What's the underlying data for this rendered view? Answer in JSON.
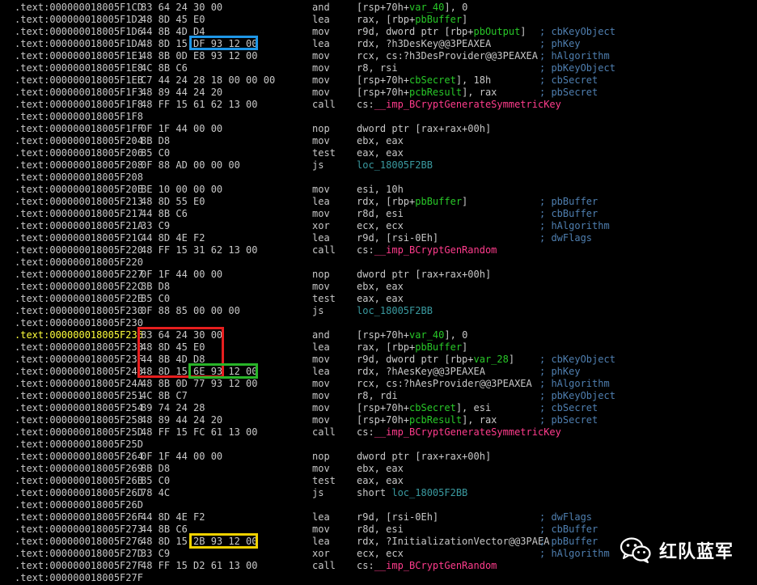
{
  "colors": {
    "background": "#000000",
    "address": "#c8c8c8",
    "current_address": "#ffff3c",
    "comment": "#4f7fb0",
    "variable": "#28c828",
    "label": "#3a9aa0",
    "import": "#ff3c8c",
    "symbol": "#ffd24a",
    "box_blue": "#1e96e6",
    "box_red": "#e61e1e",
    "box_green": "#28b428",
    "box_yellow": "#f0d200"
  },
  "lines": [
    {
      "addr": ".text:000000018005F1CD",
      "bytes": "83 64 24 30 00",
      "mnemonic": "and",
      "operands": [
        {
          "t": "[rsp+70h+",
          "k": "plain"
        },
        {
          "t": "var_40",
          "k": "green"
        },
        {
          "t": "], 0",
          "k": "plain"
        }
      ],
      "comment": ""
    },
    {
      "addr": ".text:000000018005F1D2",
      "bytes": "48 8D 45 E0",
      "mnemonic": "lea",
      "operands": [
        {
          "t": "rax, [rbp+",
          "k": "plain"
        },
        {
          "t": "pbBuffer",
          "k": "green"
        },
        {
          "t": "]",
          "k": "plain"
        }
      ],
      "comment": ""
    },
    {
      "addr": ".text:000000018005F1D6",
      "bytes": "44 8B 4D D4",
      "mnemonic": "mov",
      "operands": [
        {
          "t": "r9d, dword ptr [rbp+",
          "k": "plain"
        },
        {
          "t": "pbOutput",
          "k": "green"
        },
        {
          "t": "]",
          "k": "plain"
        }
      ],
      "comment": "; cbKeyObject"
    },
    {
      "addr": ".text:000000018005F1DA",
      "bytes": "48 8D 15 DF 93 12 00",
      "mnemonic": "lea",
      "operands": [
        {
          "t": "rdx, ?h3DesKey@@3PEAXEA",
          "k": "plain"
        }
      ],
      "comment": "; phKey"
    },
    {
      "addr": ".text:000000018005F1E1",
      "bytes": "48 8B 0D E8 93 12 00",
      "mnemonic": "mov",
      "operands": [
        {
          "t": "rcx, cs:?h3DesProvider@@3PEAXEA",
          "k": "plain"
        }
      ],
      "comment": "; hAlgorithm"
    },
    {
      "addr": ".text:000000018005F1E8",
      "bytes": "4C 8B C6",
      "mnemonic": "mov",
      "operands": [
        {
          "t": "r8, rsi",
          "k": "plain"
        }
      ],
      "comment": "; pbKeyObject"
    },
    {
      "addr": ".text:000000018005F1EB",
      "bytes": "C7 44 24 28 18 00 00 00",
      "mnemonic": "mov",
      "operands": [
        {
          "t": "[rsp+70h+",
          "k": "plain"
        },
        {
          "t": "cbSecret",
          "k": "green"
        },
        {
          "t": "], 18h",
          "k": "plain"
        }
      ],
      "comment": "; cbSecret"
    },
    {
      "addr": ".text:000000018005F1F3",
      "bytes": "48 89 44 24 20",
      "mnemonic": "mov",
      "operands": [
        {
          "t": "[rsp+70h+",
          "k": "plain"
        },
        {
          "t": "pcbResult",
          "k": "green"
        },
        {
          "t": "], rax",
          "k": "plain"
        }
      ],
      "comment": "; pbSecret"
    },
    {
      "addr": ".text:000000018005F1F8",
      "bytes": "48 FF 15 61 62 13 00",
      "mnemonic": "call",
      "operands": [
        {
          "t": "cs:",
          "k": "plain"
        },
        {
          "t": "__imp_BCryptGenerateSymmetricKey",
          "k": "pink"
        }
      ],
      "comment": ""
    },
    {
      "addr": ".text:000000018005F1F8",
      "bytes": "",
      "mnemonic": "",
      "operands": [],
      "comment": ""
    },
    {
      "addr": ".text:000000018005F1FF",
      "bytes": "0F 1F 44 00 00",
      "mnemonic": "nop",
      "operands": [
        {
          "t": "dword ptr [rax+rax+00h]",
          "k": "plain"
        }
      ],
      "comment": ""
    },
    {
      "addr": ".text:000000018005F204",
      "bytes": "8B D8",
      "mnemonic": "mov",
      "operands": [
        {
          "t": "ebx, eax",
          "k": "plain"
        }
      ],
      "comment": ""
    },
    {
      "addr": ".text:000000018005F206",
      "bytes": "85 C0",
      "mnemonic": "test",
      "operands": [
        {
          "t": "eax, eax",
          "k": "plain"
        }
      ],
      "comment": ""
    },
    {
      "addr": ".text:000000018005F208",
      "bytes": "0F 88 AD 00 00 00",
      "mnemonic": "js",
      "operands": [
        {
          "t": "loc_18005F2BB",
          "k": "teal"
        }
      ],
      "comment": ""
    },
    {
      "addr": ".text:000000018005F208",
      "bytes": "",
      "mnemonic": "",
      "operands": [],
      "comment": ""
    },
    {
      "addr": ".text:000000018005F20E",
      "bytes": "BE 10 00 00 00",
      "mnemonic": "mov",
      "operands": [
        {
          "t": "esi, 10h",
          "k": "plain"
        }
      ],
      "comment": ""
    },
    {
      "addr": ".text:000000018005F213",
      "bytes": "48 8D 55 E0",
      "mnemonic": "lea",
      "operands": [
        {
          "t": "rdx, [rbp+",
          "k": "plain"
        },
        {
          "t": "pbBuffer",
          "k": "green"
        },
        {
          "t": "]",
          "k": "plain"
        }
      ],
      "comment": "; pbBuffer"
    },
    {
      "addr": ".text:000000018005F217",
      "bytes": "44 8B C6",
      "mnemonic": "mov",
      "operands": [
        {
          "t": "r8d, esi",
          "k": "plain"
        }
      ],
      "comment": "; cbBuffer"
    },
    {
      "addr": ".text:000000018005F21A",
      "bytes": "33 C9",
      "mnemonic": "xor",
      "operands": [
        {
          "t": "ecx, ecx",
          "k": "plain"
        }
      ],
      "comment": "; hAlgorithm"
    },
    {
      "addr": ".text:000000018005F21C",
      "bytes": "44 8D 4E F2",
      "mnemonic": "lea",
      "operands": [
        {
          "t": "r9d, [rsi-0Eh]",
          "k": "plain"
        }
      ],
      "comment": "; dwFlags"
    },
    {
      "addr": ".text:000000018005F220",
      "bytes": "48 FF 15 31 62 13 00",
      "mnemonic": "call",
      "operands": [
        {
          "t": "cs:",
          "k": "plain"
        },
        {
          "t": "__imp_BCryptGenRandom",
          "k": "pink"
        }
      ],
      "comment": ""
    },
    {
      "addr": ".text:000000018005F220",
      "bytes": "",
      "mnemonic": "",
      "operands": [],
      "comment": ""
    },
    {
      "addr": ".text:000000018005F227",
      "bytes": "0F 1F 44 00 00",
      "mnemonic": "nop",
      "operands": [
        {
          "t": "dword ptr [rax+rax+00h]",
          "k": "plain"
        }
      ],
      "comment": ""
    },
    {
      "addr": ".text:000000018005F22C",
      "bytes": "8B D8",
      "mnemonic": "mov",
      "operands": [
        {
          "t": "ebx, eax",
          "k": "plain"
        }
      ],
      "comment": ""
    },
    {
      "addr": ".text:000000018005F22E",
      "bytes": "85 C0",
      "mnemonic": "test",
      "operands": [
        {
          "t": "eax, eax",
          "k": "plain"
        }
      ],
      "comment": ""
    },
    {
      "addr": ".text:000000018005F230",
      "bytes": "0F 88 85 00 00 00",
      "mnemonic": "js",
      "operands": [
        {
          "t": "loc_18005F2BB",
          "k": "teal"
        }
      ],
      "comment": ""
    },
    {
      "addr": ".text:000000018005F230",
      "bytes": "",
      "mnemonic": "",
      "operands": [],
      "comment": ""
    },
    {
      "addr": ".text:000000018005F236",
      "bytes": "83 64 24 30 00",
      "mnemonic": "and",
      "operands": [
        {
          "t": "[rsp+70h+",
          "k": "plain"
        },
        {
          "t": "var_40",
          "k": "green"
        },
        {
          "t": "], 0",
          "k": "plain"
        }
      ],
      "comment": "",
      "current": true
    },
    {
      "addr": ".text:000000018005F23B",
      "bytes": "48 8D 45 E0",
      "mnemonic": "lea",
      "operands": [
        {
          "t": "rax, [rbp+",
          "k": "plain"
        },
        {
          "t": "pbBuffer",
          "k": "green"
        },
        {
          "t": "]",
          "k": "plain"
        }
      ],
      "comment": ""
    },
    {
      "addr": ".text:000000018005F23F",
      "bytes": "44 8B 4D D8",
      "mnemonic": "mov",
      "operands": [
        {
          "t": "r9d, dword ptr [rbp+",
          "k": "plain"
        },
        {
          "t": "var_28",
          "k": "green"
        },
        {
          "t": "]",
          "k": "plain"
        }
      ],
      "comment": "; cbKeyObject"
    },
    {
      "addr": ".text:000000018005F243",
      "bytes": "48 8D 15 6E 93 12 00",
      "mnemonic": "lea",
      "operands": [
        {
          "t": "rdx, ?hAesKey@@3PEAXEA",
          "k": "plain"
        }
      ],
      "comment": "; phKey"
    },
    {
      "addr": ".text:000000018005F24A",
      "bytes": "48 8B 0D 77 93 12 00",
      "mnemonic": "mov",
      "operands": [
        {
          "t": "rcx, cs:?hAesProvider@@3PEAXEA",
          "k": "plain"
        }
      ],
      "comment": "; hAlgorithm"
    },
    {
      "addr": ".text:000000018005F251",
      "bytes": "4C 8B C7",
      "mnemonic": "mov",
      "operands": [
        {
          "t": "r8, rdi",
          "k": "plain"
        }
      ],
      "comment": "; pbKeyObject"
    },
    {
      "addr": ".text:000000018005F254",
      "bytes": "89 74 24 28",
      "mnemonic": "mov",
      "operands": [
        {
          "t": "[rsp+70h+",
          "k": "plain"
        },
        {
          "t": "cbSecret",
          "k": "green"
        },
        {
          "t": "], esi",
          "k": "plain"
        }
      ],
      "comment": "; cbSecret"
    },
    {
      "addr": ".text:000000018005F258",
      "bytes": "48 89 44 24 20",
      "mnemonic": "mov",
      "operands": [
        {
          "t": "[rsp+70h+",
          "k": "plain"
        },
        {
          "t": "pcbResult",
          "k": "green"
        },
        {
          "t": "], rax",
          "k": "plain"
        }
      ],
      "comment": "; pbSecret"
    },
    {
      "addr": ".text:000000018005F25D",
      "bytes": "48 FF 15 FC 61 13 00",
      "mnemonic": "call",
      "operands": [
        {
          "t": "cs:",
          "k": "plain"
        },
        {
          "t": "__imp_BCryptGenerateSymmetricKey",
          "k": "pink"
        }
      ],
      "comment": ""
    },
    {
      "addr": ".text:000000018005F25D",
      "bytes": "",
      "mnemonic": "",
      "operands": [],
      "comment": ""
    },
    {
      "addr": ".text:000000018005F264",
      "bytes": "0F 1F 44 00 00",
      "mnemonic": "nop",
      "operands": [
        {
          "t": "dword ptr [rax+rax+00h]",
          "k": "plain"
        }
      ],
      "comment": ""
    },
    {
      "addr": ".text:000000018005F269",
      "bytes": "8B D8",
      "mnemonic": "mov",
      "operands": [
        {
          "t": "ebx, eax",
          "k": "plain"
        }
      ],
      "comment": ""
    },
    {
      "addr": ".text:000000018005F26B",
      "bytes": "85 C0",
      "mnemonic": "test",
      "operands": [
        {
          "t": "eax, eax",
          "k": "plain"
        }
      ],
      "comment": ""
    },
    {
      "addr": ".text:000000018005F26D",
      "bytes": "78 4C",
      "mnemonic": "js",
      "operands": [
        {
          "t": "short ",
          "k": "plain"
        },
        {
          "t": "loc_18005F2BB",
          "k": "teal"
        }
      ],
      "comment": ""
    },
    {
      "addr": ".text:000000018005F26D",
      "bytes": "",
      "mnemonic": "",
      "operands": [],
      "comment": ""
    },
    {
      "addr": ".text:000000018005F26F",
      "bytes": "44 8D 4E F2",
      "mnemonic": "lea",
      "operands": [
        {
          "t": "r9d, [rsi-0Eh]",
          "k": "plain"
        }
      ],
      "comment": "; dwFlags"
    },
    {
      "addr": ".text:000000018005F273",
      "bytes": "44 8B C6",
      "mnemonic": "mov",
      "operands": [
        {
          "t": "r8d, esi",
          "k": "plain"
        }
      ],
      "comment": "; cbBuffer"
    },
    {
      "addr": ".text:000000018005F276",
      "bytes": "48 8D 15 2B 93 12 00",
      "mnemonic": "lea",
      "operands": [
        {
          "t": "rdx, ?InitializationVector@@3PAEA",
          "k": "plain"
        }
      ],
      "comment": "; pbBuffer"
    },
    {
      "addr": ".text:000000018005F27D",
      "bytes": "33 C9",
      "mnemonic": "xor",
      "operands": [
        {
          "t": "ecx, ecx",
          "k": "plain"
        }
      ],
      "comment": "; hAlgorithm"
    },
    {
      "addr": ".text:000000018005F27F",
      "bytes": "48 FF 15 D2 61 13 00",
      "mnemonic": "call",
      "operands": [
        {
          "t": "cs:",
          "k": "plain"
        },
        {
          "t": "__imp_BCryptGenRandom",
          "k": "pink"
        }
      ],
      "comment": ""
    },
    {
      "addr": ".text:000000018005F27F",
      "bytes": "",
      "mnemonic": "",
      "operands": [],
      "comment": ""
    }
  ],
  "watermark": {
    "text": "红队蓝军",
    "icon": "wechat-icon"
  }
}
